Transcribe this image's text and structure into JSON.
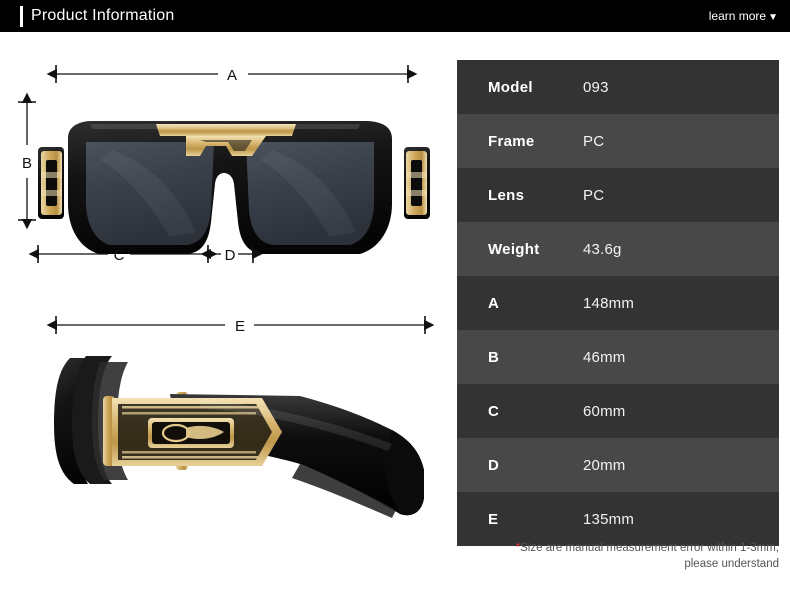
{
  "header": {
    "title": "Product Information",
    "learn_more_label": "learn more",
    "caret_icon": "chevron-down-icon",
    "background_color": "#000000",
    "accent_color": "#ffffff"
  },
  "product_images": {
    "front_view": {
      "alt": "black-gold-square-sunglasses-front-view",
      "frame_color": "#111111",
      "lens_color": "#3a4049",
      "accent_color": "#d9b36a"
    },
    "side_view": {
      "alt": "black-gold-square-sunglasses-side-view",
      "frame_color": "#111111",
      "accent_color": "#d9b36a"
    }
  },
  "dimension_markers": [
    {
      "label": "A",
      "orientation": "horizontal",
      "view": "front",
      "measures": "total frame width"
    },
    {
      "label": "B",
      "orientation": "vertical",
      "view": "front",
      "measures": "lens height"
    },
    {
      "label": "C",
      "orientation": "horizontal",
      "view": "front",
      "measures": "lens width"
    },
    {
      "label": "D",
      "orientation": "horizontal",
      "view": "front",
      "measures": "bridge width"
    },
    {
      "label": "E",
      "orientation": "horizontal",
      "view": "side",
      "measures": "temple length"
    }
  ],
  "spec_table": {
    "row_colors": {
      "odd": "#333333",
      "even": "#484848"
    },
    "rows": [
      {
        "key": "Model",
        "value": "093"
      },
      {
        "key": "Frame",
        "value": "PC"
      },
      {
        "key": "Lens",
        "value": "PC"
      },
      {
        "key": "Weight",
        "value": "43.6g"
      },
      {
        "key": "A",
        "value": "148mm"
      },
      {
        "key": "B",
        "value": "46mm"
      },
      {
        "key": "C",
        "value": "60mm"
      },
      {
        "key": "D",
        "value": "20mm"
      },
      {
        "key": "E",
        "value": "135mm"
      }
    ]
  },
  "footnote": {
    "star": "*",
    "line1": "Size are manual measurement error within 1-3mm,",
    "line2": "please understand",
    "star_color": "#e03030"
  }
}
